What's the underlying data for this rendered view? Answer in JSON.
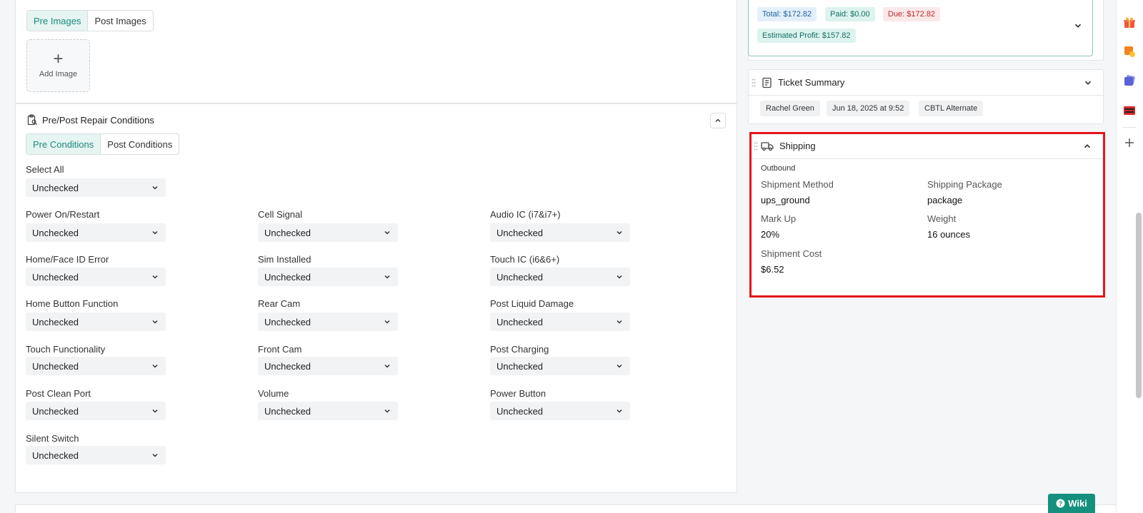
{
  "images": {
    "tabs": [
      {
        "label": "Pre Images",
        "active": true
      },
      {
        "label": "Post Images",
        "active": false
      }
    ],
    "add_label": "Add Image"
  },
  "conditions": {
    "title": "Pre/Post Repair Conditions",
    "tabs": [
      {
        "label": "Pre Conditions",
        "active": true
      },
      {
        "label": "Post Conditions",
        "active": false
      }
    ],
    "select_all": {
      "label": "Select All",
      "value": "Unchecked"
    },
    "col1": [
      {
        "label": "Power On/Restart",
        "value": "Unchecked"
      },
      {
        "label": "Home/Face ID Error",
        "value": "Unchecked"
      },
      {
        "label": "Home Button Function",
        "value": "Unchecked"
      },
      {
        "label": "Touch Functionality",
        "value": "Unchecked"
      },
      {
        "label": "Post Clean Port",
        "value": "Unchecked"
      },
      {
        "label": "Silent Switch",
        "value": "Unchecked"
      }
    ],
    "col2": [
      {
        "label": "Cell Signal",
        "value": "Unchecked"
      },
      {
        "label": "Sim Installed",
        "value": "Unchecked"
      },
      {
        "label": "Rear Cam",
        "value": "Unchecked"
      },
      {
        "label": "Front Cam",
        "value": "Unchecked"
      },
      {
        "label": "Volume",
        "value": "Unchecked"
      }
    ],
    "col3": [
      {
        "label": "Audio IC (i7&i7+)",
        "value": "Unchecked"
      },
      {
        "label": "Touch IC (i6&6+)",
        "value": "Unchecked"
      },
      {
        "label": "Post Liquid Damage",
        "value": "Unchecked"
      },
      {
        "label": "Post Charging",
        "value": "Unchecked"
      },
      {
        "label": "Power Button",
        "value": "Unchecked"
      }
    ]
  },
  "payment": {
    "total": "Total: $172.82",
    "paid": "Paid: $0.00",
    "due": "Due: $172.82",
    "profit": "Estimated Profit: $157.82"
  },
  "ticket_summary": {
    "title": "Ticket Summary",
    "tags": [
      "Rachel Green",
      "Jun 18, 2025 at 9:52",
      "CBTL Alternate"
    ]
  },
  "shipping": {
    "title": "Shipping",
    "direction": "Outbound",
    "method_label": "Shipment Method",
    "method_value": "ups_ground",
    "package_label": "Shipping Package",
    "package_value": "package",
    "markup_label": "Mark Up",
    "markup_value": "20%",
    "weight_label": "Weight",
    "weight_value": "16 ounces",
    "cost_label": "Shipment Cost",
    "cost_value": "$6.52"
  },
  "wiki_label": "Wiki",
  "colors": {
    "accent": "#16907e",
    "highlight": "#e4141b",
    "due": "#c0272d"
  }
}
